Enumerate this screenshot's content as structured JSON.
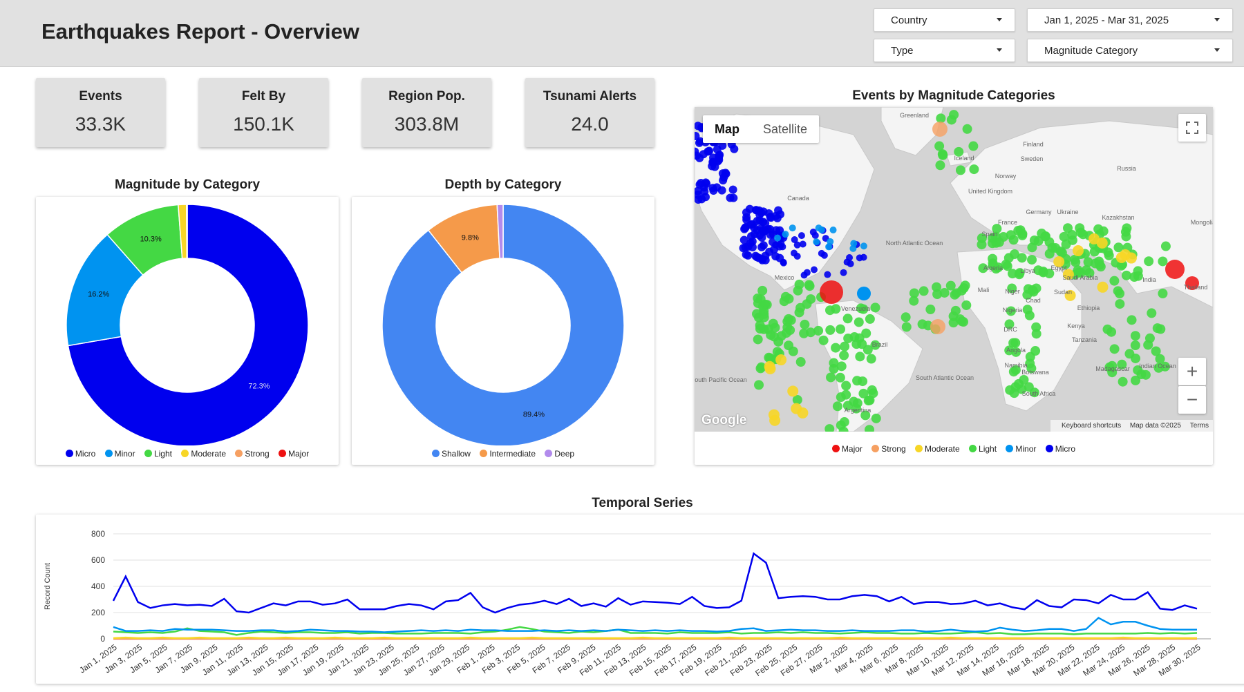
{
  "header": {
    "title": "Earthquakes Report - Overview",
    "filters": {
      "country": "Country",
      "date_range": "Jan 1, 2025 - Mar 31, 2025",
      "type": "Type",
      "magnitude_category": "Magnitude Category"
    }
  },
  "kpis": [
    {
      "label": "Events",
      "value": "33.3K"
    },
    {
      "label": "Felt By",
      "value": "150.1K"
    },
    {
      "label": "Region Pop.",
      "value": "303.8M"
    },
    {
      "label": "Tsunami Alerts",
      "value": "24.0"
    }
  ],
  "colors": {
    "micro": "#0000ee",
    "minor": "#0093f0",
    "light": "#44d844",
    "moderate": "#f7d626",
    "strong": "#f6a062",
    "major": "#ee1111",
    "shallow": "#4386f2",
    "intermediate": "#f59a4a",
    "deep": "#b28bec"
  },
  "magnitude_chart": {
    "title": "Magnitude by Category",
    "legend": [
      "Micro",
      "Minor",
      "Light",
      "Moderate",
      "Strong",
      "Major"
    ]
  },
  "depth_chart": {
    "title": "Depth by Category",
    "legend": [
      "Shallow",
      "Intermediate",
      "Deep"
    ]
  },
  "map": {
    "title": "Events by Magnitude Categories",
    "tab_map": "Map",
    "tab_satellite": "Satellite",
    "logo": "Google",
    "footer": {
      "shortcuts": "Keyboard shortcuts",
      "data": "Map data ©2025",
      "terms": "Terms"
    },
    "legend": [
      "Major",
      "Strong",
      "Moderate",
      "Light",
      "Minor",
      "Micro"
    ],
    "places": [
      "Greenland",
      "Finland",
      "Sweden",
      "Russia",
      "Norway",
      "Iceland",
      "Canada",
      "United Kingdom",
      "Germany",
      "Ukraine",
      "Kazakhstan",
      "France",
      "Spain",
      "Mongolia",
      "North Atlantic Ocean",
      "Mexico",
      "Algeria",
      "Libya",
      "Egypt",
      "Saudi Arabia",
      "India",
      "Mali",
      "Niger",
      "Chad",
      "Sudan",
      "Nigeria",
      "Ethiopia",
      "Venezuela",
      "DRC",
      "Kenya",
      "Tanzania",
      "Brazil",
      "Angola",
      "Madagascar",
      "Namibia",
      "Botswana",
      "South Pacific Ocean",
      "South Atlantic Ocean",
      "Indian Ocean",
      "South Africa",
      "Argentina",
      "Thailand"
    ]
  },
  "temporal": {
    "title": "Temporal Series",
    "ylabel": "Record Count",
    "yticks": [
      "800",
      "600",
      "400",
      "200",
      "0"
    ]
  },
  "chart_data": [
    {
      "type": "pie",
      "title": "Magnitude by Category",
      "labels": [
        "Micro",
        "Minor",
        "Light",
        "Moderate",
        "Strong",
        "Major"
      ],
      "values": [
        72.3,
        16.2,
        10.3,
        1.1,
        0.07,
        0.03
      ],
      "value_labels": [
        "72.3%",
        "16.2%",
        "10.3%"
      ],
      "donut": true
    },
    {
      "type": "pie",
      "title": "Depth by Category",
      "labels": [
        "Shallow",
        "Intermediate",
        "Deep"
      ],
      "values": [
        89.4,
        9.8,
        0.8
      ],
      "value_labels": [
        "89.4%",
        "9.8%"
      ],
      "donut": true
    },
    {
      "type": "line",
      "title": "Temporal Series",
      "ylabel": "Record Count",
      "ylim": [
        0,
        800
      ],
      "x_tick_labels": [
        "Jan 1, 2025",
        "Jan 3, 2025",
        "Jan 5, 2025",
        "Jan 7, 2025",
        "Jan 9, 2025",
        "Jan 11, 2025",
        "Jan 13, 2025",
        "Jan 15, 2025",
        "Jan 17, 2025",
        "Jan 19, 2025",
        "Jan 21, 2025",
        "Jan 23, 2025",
        "Jan 25, 2025",
        "Jan 27, 2025",
        "Jan 29, 2025",
        "Feb 1, 2025",
        "Feb 3, 2025",
        "Feb 5, 2025",
        "Feb 7, 2025",
        "Feb 9, 2025",
        "Feb 11, 2025",
        "Feb 13, 2025",
        "Feb 15, 2025",
        "Feb 17, 2025",
        "Feb 19, 2025",
        "Feb 21, 2025",
        "Feb 23, 2025",
        "Feb 25, 2025",
        "Feb 27, 2025",
        "Mar 2, 2025",
        "Mar 4, 2025",
        "Mar 6, 2025",
        "Mar 8, 2025",
        "Mar 10, 2025",
        "Mar 12, 2025",
        "Mar 14, 2025",
        "Mar 16, 2025",
        "Mar 18, 2025",
        "Mar 20, 2025",
        "Mar 22, 2025",
        "Mar 24, 2025",
        "Mar 26, 2025",
        "Mar 28, 2025",
        "Mar 30, 2025"
      ],
      "series": [
        {
          "name": "Micro",
          "values": [
            290,
            475,
            280,
            235,
            255,
            265,
            255,
            260,
            250,
            305,
            210,
            200,
            235,
            270,
            255,
            285,
            285,
            260,
            270,
            300,
            225,
            225,
            225,
            250,
            265,
            255,
            225,
            285,
            295,
            350,
            240,
            200,
            235,
            260,
            270,
            290,
            265,
            305,
            250,
            270,
            245,
            310,
            260,
            285,
            280,
            275,
            265,
            320,
            250,
            235,
            240,
            290,
            650,
            580,
            310,
            320,
            325,
            320,
            300,
            300,
            325,
            335,
            325,
            285,
            320,
            265,
            280,
            280,
            265,
            270,
            290,
            255,
            270,
            240,
            225,
            295,
            250,
            240,
            300,
            295,
            270,
            335,
            300,
            300,
            355,
            230,
            220,
            255,
            230
          ]
        },
        {
          "name": "Minor",
          "values": [
            90,
            60,
            60,
            65,
            60,
            75,
            70,
            70,
            70,
            65,
            60,
            60,
            65,
            65,
            55,
            60,
            70,
            65,
            60,
            60,
            55,
            55,
            50,
            55,
            60,
            65,
            60,
            65,
            60,
            70,
            65,
            65,
            60,
            60,
            60,
            65,
            60,
            65,
            60,
            65,
            60,
            70,
            65,
            60,
            65,
            60,
            65,
            60,
            60,
            55,
            60,
            75,
            80,
            60,
            65,
            70,
            65,
            65,
            60,
            60,
            65,
            60,
            60,
            60,
            65,
            65,
            55,
            60,
            70,
            60,
            55,
            60,
            85,
            70,
            60,
            65,
            75,
            75,
            60,
            75,
            160,
            110,
            130,
            130,
            100,
            75,
            70,
            70,
            70
          ]
        },
        {
          "name": "Light",
          "values": [
            55,
            50,
            45,
            50,
            45,
            55,
            80,
            60,
            55,
            50,
            30,
            45,
            55,
            50,
            45,
            50,
            50,
            45,
            45,
            50,
            40,
            45,
            45,
            40,
            40,
            40,
            45,
            45,
            45,
            40,
            50,
            55,
            70,
            90,
            75,
            55,
            50,
            45,
            55,
            50,
            60,
            70,
            45,
            45,
            45,
            40,
            50,
            45,
            45,
            45,
            50,
            40,
            45,
            45,
            50,
            45,
            50,
            45,
            45,
            40,
            45,
            50,
            45,
            45,
            40,
            40,
            45,
            40,
            40,
            45,
            50,
            40,
            45,
            35,
            35,
            40,
            40,
            40,
            35,
            40,
            40,
            40,
            40,
            40,
            45,
            40,
            45,
            40,
            45
          ]
        },
        {
          "name": "Moderate",
          "values": [
            5,
            10,
            5,
            5,
            10,
            5,
            5,
            10,
            5,
            5,
            5,
            10,
            5,
            5,
            10,
            5,
            5,
            5,
            10,
            5,
            5,
            5,
            10,
            5,
            5,
            5,
            5,
            5,
            5,
            10,
            5,
            5,
            5,
            5,
            10,
            5,
            5,
            5,
            5,
            5,
            5,
            5,
            5,
            10,
            5,
            5,
            5,
            5,
            5,
            5,
            10,
            5,
            5,
            5,
            5,
            5,
            5,
            5,
            5,
            10,
            5,
            5,
            5,
            5,
            5,
            5,
            5,
            5,
            10,
            5,
            5,
            5,
            5,
            5,
            5,
            5,
            5,
            5,
            5,
            5,
            5,
            5,
            10,
            5,
            5,
            5,
            5,
            5,
            5
          ]
        },
        {
          "name": "Strong",
          "values": [
            1,
            1,
            0,
            0,
            1,
            0,
            0,
            0,
            1,
            0,
            0,
            2,
            0,
            0,
            0,
            1,
            0,
            0,
            0,
            0,
            0,
            1,
            0,
            0,
            0,
            0,
            0,
            0,
            1,
            0,
            0,
            0,
            0,
            0,
            0,
            1,
            0,
            0,
            0,
            0,
            0,
            0,
            0,
            0,
            1,
            0,
            0,
            0,
            0,
            0,
            0,
            0,
            0,
            1,
            0,
            0,
            0,
            0,
            0,
            0,
            0,
            0,
            0,
            0,
            1,
            0,
            0,
            0,
            0,
            0,
            0,
            0,
            0,
            0,
            0,
            0,
            1,
            0,
            0,
            0,
            0,
            0,
            0,
            0,
            0,
            0,
            0,
            0,
            0
          ]
        },
        {
          "name": "Major",
          "values": [
            0,
            0,
            0,
            0,
            0,
            0,
            0,
            0,
            0,
            0,
            0,
            0,
            0,
            0,
            0,
            0,
            0,
            0,
            0,
            0,
            0,
            0,
            0,
            0,
            0,
            0,
            0,
            0,
            0,
            0,
            0,
            0,
            0,
            0,
            0,
            0,
            0,
            0,
            0,
            0,
            0,
            0,
            0,
            0,
            0,
            0,
            0,
            0,
            0,
            0,
            0,
            0,
            0,
            0,
            0,
            0,
            0,
            0,
            0,
            0,
            0,
            0,
            0,
            0,
            0,
            0,
            0,
            0,
            0,
            0,
            0,
            0,
            0,
            0,
            0,
            0,
            0,
            0,
            0,
            0,
            0,
            0,
            0,
            0,
            0,
            0,
            0,
            0,
            0
          ]
        }
      ]
    }
  ]
}
